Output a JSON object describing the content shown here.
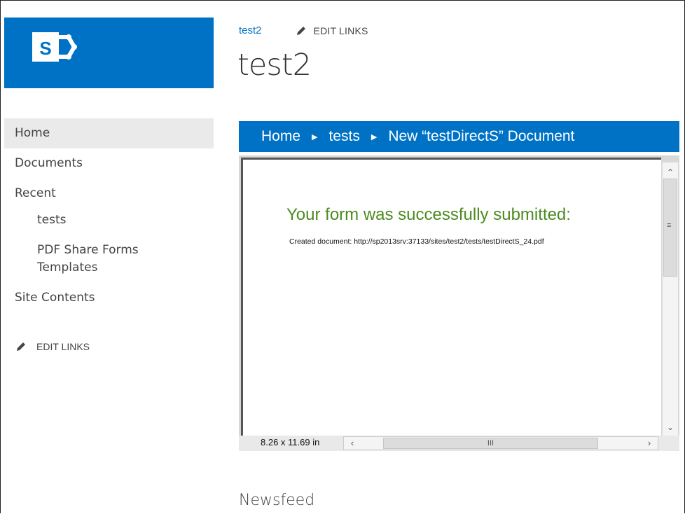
{
  "header": {
    "site_link": "test2",
    "edit_links_label": "EDIT LINKS",
    "site_title": "test2"
  },
  "nav": {
    "items": [
      {
        "label": "Home",
        "selected": true
      },
      {
        "label": "Documents"
      },
      {
        "label": "Recent"
      }
    ],
    "sub_items": [
      {
        "label": "tests"
      },
      {
        "label": "PDF Share Forms Templates"
      }
    ],
    "site_contents": "Site Contents",
    "edit_links_label": "EDIT LINKS"
  },
  "breadcrumb": {
    "items": [
      "Home",
      "tests",
      "New “testDirectS” Document"
    ]
  },
  "viewer": {
    "success_message": "Your form was successfully submitted:",
    "created_document": "Created document: http://sp2013srv:37133/sites/test2/tests/testDirectS_24.pdf",
    "page_size": "8.26 x 11.69 in"
  },
  "newsfeed": {
    "title": "Newsfeed"
  },
  "colors": {
    "brand_blue": "#0072c6",
    "success_green": "#4b8b1f"
  },
  "icons": [
    "sharepoint-logo",
    "pencil-icon",
    "chevron-right-icon",
    "scroll-up-arrow-icon",
    "scroll-down-arrow-icon",
    "scroll-left-arrow-icon",
    "scroll-right-arrow-icon"
  ]
}
